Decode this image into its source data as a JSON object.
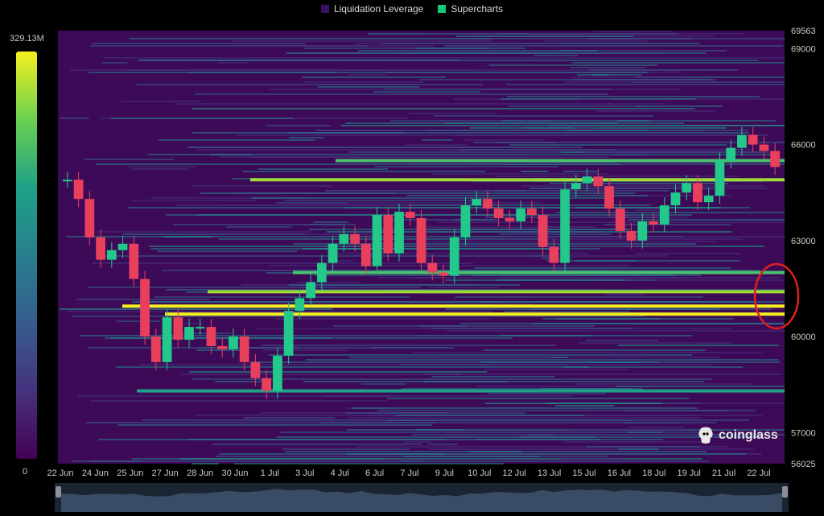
{
  "legend": [
    {
      "label": "Liquidation Leverage",
      "color": "#3a0f5e"
    },
    {
      "label": "Supercharts",
      "color": "#14c97a"
    }
  ],
  "colorbar": {
    "max_label": "329.13M",
    "min_label": "0",
    "colors": [
      "#f6ef1f",
      "#6bd04f",
      "#1fa187",
      "#277f8e",
      "#365c8d",
      "#46327e",
      "#440154"
    ]
  },
  "watermark": "coinglass",
  "annotation": {
    "type": "red-circle",
    "note": "highlighted liquidation cluster",
    "color": "#e0201b"
  },
  "chart_data": {
    "type": "heatmap",
    "title": "",
    "xlabel": "",
    "ylabel": "",
    "ylim": [
      56025,
      69563
    ],
    "y_ticks": [
      {
        "label": "69563",
        "value": 69563
      },
      {
        "label": "69000",
        "value": 69000
      },
      {
        "label": "66000",
        "value": 66000
      },
      {
        "label": "63000",
        "value": 63000
      },
      {
        "label": "60000",
        "value": 60000
      },
      {
        "label": "57000",
        "value": 57000
      },
      {
        "label": "56025",
        "value": 56025
      }
    ],
    "x_ticks": [
      "22 Jun",
      "24 Jun",
      "25 Jun",
      "27 Jun",
      "28 Jun",
      "30 Jun",
      "1 Jul",
      "3 Jul",
      "4 Jul",
      "6 Jul",
      "7 Jul",
      "9 Jul",
      "10 Jul",
      "12 Jul",
      "13 Jul",
      "15 Jul",
      "16 Jul",
      "18 Jul",
      "19 Jul",
      "21 Jul",
      "22 Jul"
    ],
    "price_path": [
      64900,
      64300,
      63100,
      62400,
      62700,
      62900,
      61800,
      60000,
      59200,
      60600,
      59900,
      60300,
      60300,
      59700,
      59600,
      60000,
      59200,
      58700,
      58300,
      59400,
      60800,
      61200,
      61700,
      62300,
      62900,
      63200,
      62900,
      62200,
      63800,
      62600,
      63900,
      63700,
      62300,
      62000,
      61900,
      63100,
      64100,
      64300,
      64000,
      63700,
      63600,
      64000,
      63800,
      62800,
      62300,
      64600,
      64800,
      65000,
      64700,
      64000,
      63300,
      63000,
      63600,
      63500,
      64100,
      64500,
      64800,
      64200,
      64400,
      65500,
      65900,
      66300,
      66000,
      65800,
      65300
    ],
    "strong_levels": [
      {
        "price": 60950,
        "intensity": 1.0
      },
      {
        "price": 60700,
        "intensity": 0.95
      },
      {
        "price": 61400,
        "intensity": 0.75
      },
      {
        "price": 64900,
        "intensity": 0.85
      },
      {
        "price": 62000,
        "intensity": 0.7
      },
      {
        "price": 65500,
        "intensity": 0.6
      },
      {
        "price": 58300,
        "intensity": 0.55
      }
    ]
  }
}
